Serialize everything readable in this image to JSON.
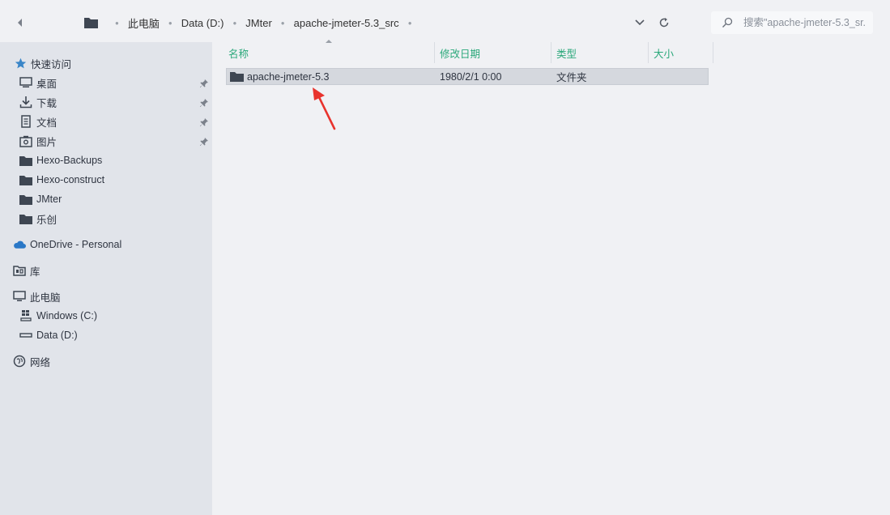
{
  "toolbar": {
    "back_icon": "chevron-left-icon",
    "breadcrumb": [
      "此电脑",
      "Data (D:)",
      "JMter",
      "apache-jmeter-5.3_src"
    ],
    "search_placeholder": "搜索\"apache-jmeter-5.3_sr..."
  },
  "sidebar": {
    "quick_access": "快速访问",
    "pinned": [
      {
        "label": "桌面",
        "icon": "desktop-icon"
      },
      {
        "label": "下载",
        "icon": "download-icon"
      },
      {
        "label": "文档",
        "icon": "document-icon"
      },
      {
        "label": "图片",
        "icon": "picture-icon"
      }
    ],
    "folders": [
      "Hexo-Backups",
      "Hexo-construct",
      "JMter",
      "乐创"
    ],
    "onedrive": "OneDrive - Personal",
    "library": "库",
    "this_pc": "此电脑",
    "drives": [
      {
        "label": "Windows (C:)",
        "icon": "windows-drive-icon"
      },
      {
        "label": "Data (D:)",
        "icon": "drive-icon"
      }
    ],
    "network": "网络"
  },
  "columns": {
    "name": "名称",
    "modified": "修改日期",
    "type": "类型",
    "size": "大小"
  },
  "files": [
    {
      "name": "apache-jmeter-5.3",
      "modified": "1980/2/1 0:00",
      "type": "文件夹",
      "size": ""
    }
  ],
  "colors": {
    "accent": "#2aa87a",
    "sidebar_bg": "#e1e4ea",
    "content_bg": "#f0f1f4",
    "annotation": "#e8332d"
  }
}
